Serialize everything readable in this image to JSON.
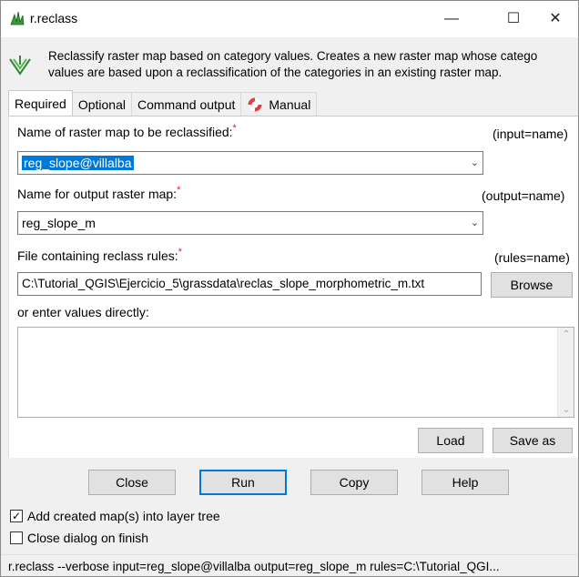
{
  "window": {
    "title": "r.reclass",
    "minimize_glyph": "—",
    "maximize_glyph": "☐",
    "close_glyph": "✕"
  },
  "header": {
    "description_line1": "Reclassify raster map based on category values. Creates a new raster map whose catego",
    "description_line2": "values are based upon a reclassification of the categories in an existing raster map."
  },
  "tabs": [
    {
      "label": "Required",
      "active": true
    },
    {
      "label": "Optional",
      "active": false
    },
    {
      "label": "Command output",
      "active": false
    },
    {
      "label": "Manual",
      "active": false
    }
  ],
  "form": {
    "input": {
      "label": "Name of raster map to be reclassified:",
      "required_mark": "*",
      "key": "(input=name)",
      "value": "reg_slope@villalba"
    },
    "output": {
      "label": "Name for output raster map:",
      "required_mark": "*",
      "key": "(output=name)",
      "value": "reg_slope_m"
    },
    "rules": {
      "label": "File containing reclass rules:",
      "required_mark": "*",
      "key": "(rules=name)",
      "value": "C:\\Tutorial_QGIS\\Ejercicio_5\\grassdata\\reclas_slope_morphometric_m.txt",
      "browse_label": "Browse"
    },
    "direct": {
      "label": "or enter values directly:",
      "value": ""
    },
    "load_label": "Load",
    "save_as_label": "Save as"
  },
  "actions": {
    "close": "Close",
    "run": "Run",
    "copy": "Copy",
    "help": "Help"
  },
  "options": {
    "add_to_tree": {
      "label": "Add created map(s) into layer tree",
      "checked": true
    },
    "close_on_finish": {
      "label": "Close dialog on finish",
      "checked": false
    }
  },
  "status_bar": "r.reclass --verbose input=reg_slope@villalba output=reg_slope_m rules=C:\\Tutorial_QGI..."
}
